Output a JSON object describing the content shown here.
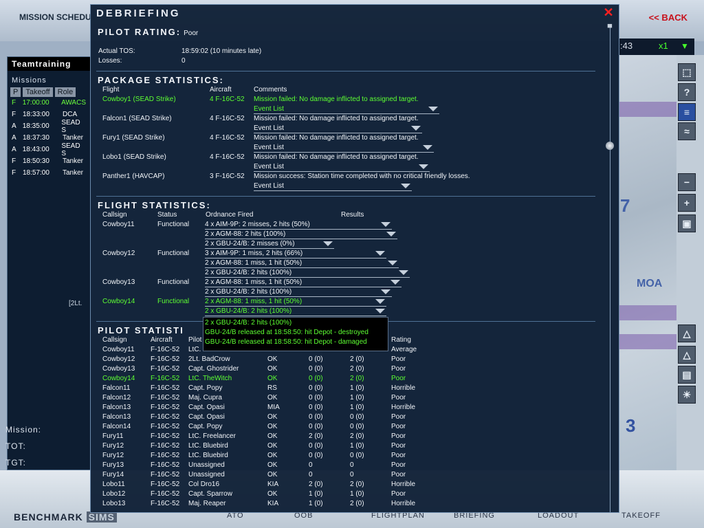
{
  "background": {
    "title": "MISSION SCHEDU",
    "back_label": "<< BACK",
    "left_panel": {
      "header": "Teamtraining",
      "missions_label": "Missions",
      "columns": [
        "P",
        "Takeoff",
        "Role"
      ],
      "rows": [
        {
          "p": "F",
          "time": "17:00:00",
          "role": "AWACS",
          "selected": true
        },
        {
          "p": "F",
          "time": "18:33:00",
          "role": "DCA",
          "selected": false
        },
        {
          "p": "A",
          "time": "18:35:00",
          "role": "SEAD S",
          "selected": false
        },
        {
          "p": "A",
          "time": "18:37:30",
          "role": "Tanker",
          "selected": false
        },
        {
          "p": "A",
          "time": "18:43:00",
          "role": "SEAD S",
          "selected": false
        },
        {
          "p": "F",
          "time": "18:50:30",
          "role": "Tanker",
          "selected": false
        },
        {
          "p": "F",
          "time": "18:57:00",
          "role": "Tanker",
          "selected": false
        }
      ],
      "note": "[2Lt.",
      "mission_label": "Mission:",
      "tot_label": "TOT:",
      "tgt_label": "TGT:"
    },
    "map": {
      "time": ":43",
      "speed": "x1",
      "moa_label": "MOA",
      "num_7": "7",
      "num_3": "3"
    },
    "toolbar_icons": [
      "cursor-icon",
      "help-icon",
      "flag-icon",
      "route-icon",
      "zoom-out-icon",
      "zoom-in-icon",
      "fit-icon",
      "threat-icon",
      "threat2-icon",
      "chart-icon",
      "weather-icon"
    ],
    "brand": "BENCHMARK",
    "brand_suffix": "SIMS",
    "nav_tabs": [
      "ATO",
      "OOB",
      "FLIGHTPLAN",
      "BRIEFING",
      "LOADOUT",
      "TAKEOFF"
    ]
  },
  "debrief": {
    "title": "Debriefing",
    "close_icon": "close-icon",
    "pilot_rating_label": "Pilot Rating:",
    "pilot_rating_value": "Poor",
    "actual_tos_label": "Actual TOS:",
    "actual_tos_value": "18:59:02 (10 minutes late)",
    "losses_label": "Losses:",
    "losses_value": "0",
    "package": {
      "heading": "Package Statistics:",
      "col_flight": "Flight",
      "col_aircraft": "Aircraft",
      "col_comments": "Comments",
      "event_list_label": "Event List",
      "rows": [
        {
          "flight": "Cowboy1 (SEAD Strike)",
          "aircraft": "4 F-16C-52",
          "comment": "Mission failed: No damage inflicted to assigned target.",
          "highlight": true
        },
        {
          "flight": "Falcon1 (SEAD Strike)",
          "aircraft": "4 F-16C-52",
          "comment": "Mission failed: No damage inflicted to assigned target.",
          "highlight": false
        },
        {
          "flight": "Fury1 (SEAD Strike)",
          "aircraft": "4 F-16C-52",
          "comment": "Mission failed: No damage inflicted to assigned target.",
          "highlight": false
        },
        {
          "flight": "Lobo1 (SEAD Strike)",
          "aircraft": "4 F-16C-52",
          "comment": "Mission failed: No damage inflicted to assigned target.",
          "highlight": false
        },
        {
          "flight": "Panther1 (HAVCAP)",
          "aircraft": "3 F-16C-52",
          "comment": "Mission success: Station time completed with no critical friendly losses.",
          "highlight": false
        }
      ]
    },
    "flight": {
      "heading": "Flight Statistics:",
      "col_callsign": "Callsign",
      "col_status": "Status",
      "col_ordnance": "Ordnance Fired",
      "col_results": "Results",
      "rows": [
        {
          "callsign": "Cowboy11",
          "status": "Functional",
          "highlight": false,
          "ordnance": [
            "4 x AIM-9P: 2 misses, 2 hits (50%)",
            "2 x AGM-88: 2 hits (100%)",
            "2 x GBU-24/B: 2 misses (0%)"
          ]
        },
        {
          "callsign": "Cowboy12",
          "status": "Functional",
          "highlight": false,
          "ordnance": [
            "3 x AIM-9P: 1 miss, 2 hits (66%)",
            "2 x AGM-88: 1 miss, 1 hit (50%)",
            "2 x GBU-24/B: 2 hits (100%)"
          ]
        },
        {
          "callsign": "Cowboy13",
          "status": "Functional",
          "highlight": false,
          "ordnance": [
            "2 x AGM-88: 1 miss, 1 hit (50%)",
            "2 x GBU-24/B: 2 hits (100%)"
          ]
        },
        {
          "callsign": "Cowboy14",
          "status": "Functional",
          "highlight": true,
          "ordnance": [
            "2 x AGM-88: 1 miss, 1 hit (50%)",
            "2 x GBU-24/B: 2 hits (100%)"
          ]
        }
      ],
      "popup_lines": [
        "2 x GBU-24/B: 2 hits (100%)",
        "GBU-24/B released at 18:58:50: hit Depot - destroyed",
        "GBU-24/B released at 18:58:50: hit Depot - damaged"
      ]
    },
    "pilot": {
      "heading": "Pilot Statisti",
      "col_callsign": "Callsign",
      "col_aircraft": "Aircraft",
      "col_pilot": "Pilot",
      "col_rating": "Rating",
      "first_row": {
        "callsign": "Cowboy11",
        "aircraft": "F-16C-52",
        "pilot": "LtC. Hunter",
        "rating": "Average"
      },
      "rows": [
        {
          "callsign": "Cowboy12",
          "aircraft": "F-16C-52",
          "pilot": "2Lt. BadCrow",
          "status": "OK",
          "aa": "0 (0)",
          "ag": "2 (0)",
          "rating": "Poor",
          "highlight": false
        },
        {
          "callsign": "Cowboy13",
          "aircraft": "F-16C-52",
          "pilot": "Capt. Ghostrider",
          "status": "OK",
          "aa": "0 (0)",
          "ag": "2 (0)",
          "rating": "Poor",
          "highlight": false
        },
        {
          "callsign": "Cowboy14",
          "aircraft": "F-16C-52",
          "pilot": "LtC. TheWitch",
          "status": "OK",
          "aa": "0 (0)",
          "ag": "2 (0)",
          "rating": "Poor",
          "highlight": true
        },
        {
          "callsign": "Falcon11",
          "aircraft": "F-16C-52",
          "pilot": "Capt. Popy",
          "status": "RS",
          "aa": "0 (0)",
          "ag": "1 (0)",
          "rating": "Horrible",
          "highlight": false
        },
        {
          "callsign": "Falcon12",
          "aircraft": "F-16C-52",
          "pilot": "Maj. Cupra",
          "status": "OK",
          "aa": "0 (0)",
          "ag": "1 (0)",
          "rating": "Poor",
          "highlight": false
        },
        {
          "callsign": "Falcon13",
          "aircraft": "F-16C-52",
          "pilot": "Capt. Opasi",
          "status": "MIA",
          "aa": "0 (0)",
          "ag": "1 (0)",
          "rating": "Horrible",
          "highlight": false
        },
        {
          "callsign": "Falcon13",
          "aircraft": "F-16C-52",
          "pilot": "Capt. Opasi",
          "status": "OK",
          "aa": "0 (0)",
          "ag": "0 (0)",
          "rating": "Poor",
          "highlight": false
        },
        {
          "callsign": "Falcon14",
          "aircraft": "F-16C-52",
          "pilot": "Capt. Popy",
          "status": "OK",
          "aa": "0 (0)",
          "ag": "0 (0)",
          "rating": "Poor",
          "highlight": false
        },
        {
          "callsign": "Fury11",
          "aircraft": "F-16C-52",
          "pilot": "LtC. Freelancer",
          "status": "OK",
          "aa": "2 (0)",
          "ag": "2 (0)",
          "rating": "Poor",
          "highlight": false
        },
        {
          "callsign": "Fury12",
          "aircraft": "F-16C-52",
          "pilot": "LtC. Bluebird",
          "status": "OK",
          "aa": "0 (0)",
          "ag": "1 (0)",
          "rating": "Poor",
          "highlight": false
        },
        {
          "callsign": "Fury12",
          "aircraft": "F-16C-52",
          "pilot": "LtC. Bluebird",
          "status": "OK",
          "aa": "0 (0)",
          "ag": "0 (0)",
          "rating": "Poor",
          "highlight": false
        },
        {
          "callsign": "Fury13",
          "aircraft": "F-16C-52",
          "pilot": "Unassigned",
          "status": "OK",
          "aa": "0",
          "ag": "0",
          "rating": "Poor",
          "highlight": false
        },
        {
          "callsign": "Fury14",
          "aircraft": "F-16C-52",
          "pilot": "Unassigned",
          "status": "OK",
          "aa": "0",
          "ag": "0",
          "rating": "Poor",
          "highlight": false
        },
        {
          "callsign": "Lobo11",
          "aircraft": "F-16C-52",
          "pilot": "Col Dro16",
          "status": "KIA",
          "aa": "2 (0)",
          "ag": "2 (0)",
          "rating": "Horrible",
          "highlight": false
        },
        {
          "callsign": "Lobo12",
          "aircraft": "F-16C-52",
          "pilot": "Capt. Sparrow",
          "status": "OK",
          "aa": "1 (0)",
          "ag": "1 (0)",
          "rating": "Poor",
          "highlight": false
        },
        {
          "callsign": "Lobo13",
          "aircraft": "F-16C-52",
          "pilot": "Maj. Reaper",
          "status": "KIA",
          "aa": "1 (0)",
          "ag": "2 (0)",
          "rating": "Horrible",
          "highlight": false
        }
      ]
    }
  }
}
